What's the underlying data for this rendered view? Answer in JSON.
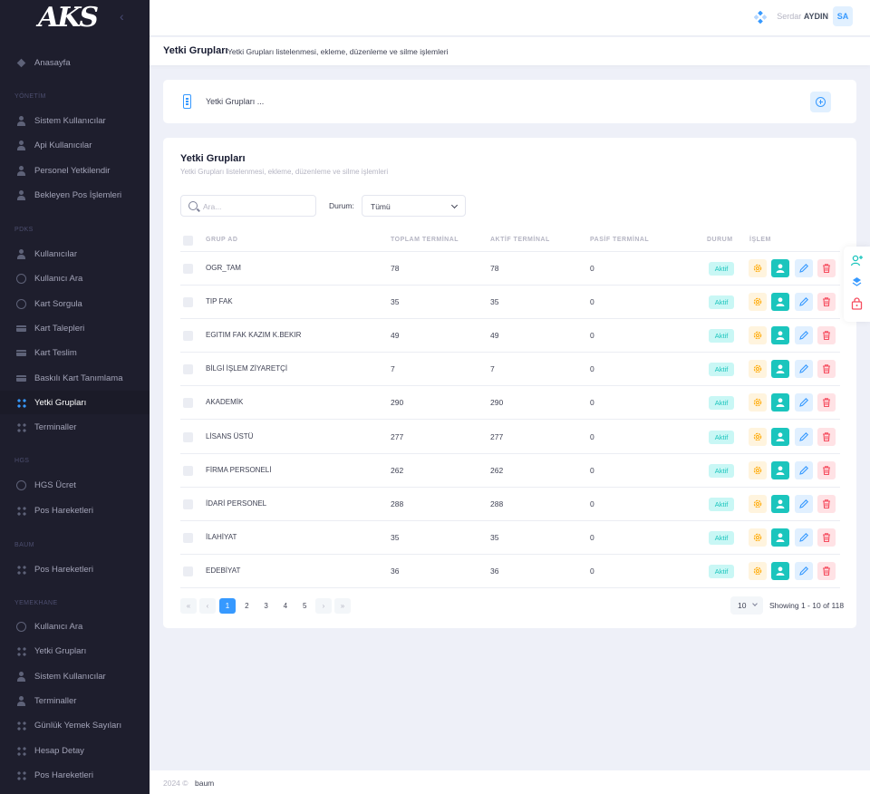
{
  "brand": {
    "logo": "AKS"
  },
  "sidebar": {
    "home": {
      "label": "Anasayfa",
      "icon": "home-icon"
    },
    "sections": [
      {
        "title": "YÖNETİM",
        "items": [
          {
            "label": "Sistem Kullanıcılar",
            "icon": "user-icon"
          },
          {
            "label": "Api Kullanıcılar",
            "icon": "user-icon"
          },
          {
            "label": "Personel Yetkilendir",
            "icon": "user-icon"
          },
          {
            "label": "Bekleyen Pos İşlemleri",
            "icon": "user-icon"
          }
        ]
      },
      {
        "title": "PDKS",
        "items": [
          {
            "label": "Kullanıcılar",
            "icon": "user-icon"
          },
          {
            "label": "Kullanıcı Ara",
            "icon": "search-icon"
          },
          {
            "label": "Kart Sorgula",
            "icon": "search-icon"
          },
          {
            "label": "Kart Talepleri",
            "icon": "card-icon"
          },
          {
            "label": "Kart Teslim",
            "icon": "card-icon"
          },
          {
            "label": "Baskılı Kart Tanımlama",
            "icon": "card-icon"
          },
          {
            "label": "Yetki Grupları",
            "icon": "grid-icon",
            "active": true
          },
          {
            "label": "Terminaller",
            "icon": "grid-icon"
          }
        ]
      },
      {
        "title": "HGS",
        "items": [
          {
            "label": "HGS Ücret",
            "icon": "search-icon"
          },
          {
            "label": "Pos Hareketleri",
            "icon": "grid-icon"
          }
        ]
      },
      {
        "title": "BAUM",
        "items": [
          {
            "label": "Pos Hareketleri",
            "icon": "grid-icon"
          }
        ]
      },
      {
        "title": "YEMEKHANE",
        "items": [
          {
            "label": "Kullanıcı Ara",
            "icon": "search-icon"
          },
          {
            "label": "Yetki Grupları",
            "icon": "grid-icon"
          },
          {
            "label": "Sistem Kullanıcılar",
            "icon": "user-icon"
          },
          {
            "label": "Terminaller",
            "icon": "user-icon"
          },
          {
            "label": "Günlük Yemek Sayıları",
            "icon": "grid-icon"
          },
          {
            "label": "Hesap Detay",
            "icon": "grid-icon"
          },
          {
            "label": "Pos Hareketleri",
            "icon": "grid-icon"
          }
        ]
      }
    ]
  },
  "header": {
    "greeting": "Serdar",
    "user_name": "AYDIN",
    "avatar_initials": "SA"
  },
  "subheader": {
    "title": "Yetki Grupları",
    "description": "Yetki Grupları listelenmesi, ekleme, düzenleme ve silme işlemleri"
  },
  "card_header": {
    "title": "Yetki Grupları ..."
  },
  "list": {
    "title": "Yetki Grupları",
    "description": "Yetki Grupları listelenmesi, ekleme, düzenleme ve silme işlemleri",
    "search_placeholder": "Ara...",
    "status_filter_label": "Durum:",
    "status_filter_value": "Tümü",
    "columns": {
      "name": "GRUP AD",
      "total": "TOPLAM TERMİNAL",
      "active": "AKTİF TERMİNAL",
      "passive": "PASİF TERMİNAL",
      "status": "DURUM",
      "action": "İŞLEM"
    },
    "rows": [
      {
        "name": "OGR_TAM",
        "total": "78",
        "active": "78",
        "passive": "0",
        "status": "Aktif"
      },
      {
        "name": "TIP FAK",
        "total": "35",
        "active": "35",
        "passive": "0",
        "status": "Aktif"
      },
      {
        "name": "EGITIM FAK KAZIM K.BEKIR",
        "total": "49",
        "active": "49",
        "passive": "0",
        "status": "Aktif"
      },
      {
        "name": "BİLGİ İŞLEM ZİYARETÇİ",
        "total": "7",
        "active": "7",
        "passive": "0",
        "status": "Aktif"
      },
      {
        "name": "AKADEMİK",
        "total": "290",
        "active": "290",
        "passive": "0",
        "status": "Aktif"
      },
      {
        "name": "LİSANS ÜSTÜ",
        "total": "277",
        "active": "277",
        "passive": "0",
        "status": "Aktif"
      },
      {
        "name": "FİRMA PERSONELİ",
        "total": "262",
        "active": "262",
        "passive": "0",
        "status": "Aktif"
      },
      {
        "name": "İDARİ PERSONEL",
        "total": "288",
        "active": "288",
        "passive": "0",
        "status": "Aktif"
      },
      {
        "name": "İLAHİYAT",
        "total": "35",
        "active": "35",
        "passive": "0",
        "status": "Aktif"
      },
      {
        "name": "EDEBİYAT",
        "total": "36",
        "active": "36",
        "passive": "0",
        "status": "Aktif"
      }
    ],
    "pagination": {
      "first": "«",
      "prev": "‹",
      "next": "›",
      "last": "»",
      "pages": [
        "1",
        "2",
        "3",
        "4",
        "5"
      ],
      "current": "1",
      "page_size": "10",
      "info": "Showing 1 - 10 of 118"
    }
  },
  "footer": {
    "year": "2024 ©",
    "brand": "baum"
  },
  "colors": {
    "primary": "#3699ff",
    "success": "#1bc5bd",
    "warning": "#ffa800",
    "danger": "#f64e60",
    "sidebar": "#1e1e2d"
  }
}
